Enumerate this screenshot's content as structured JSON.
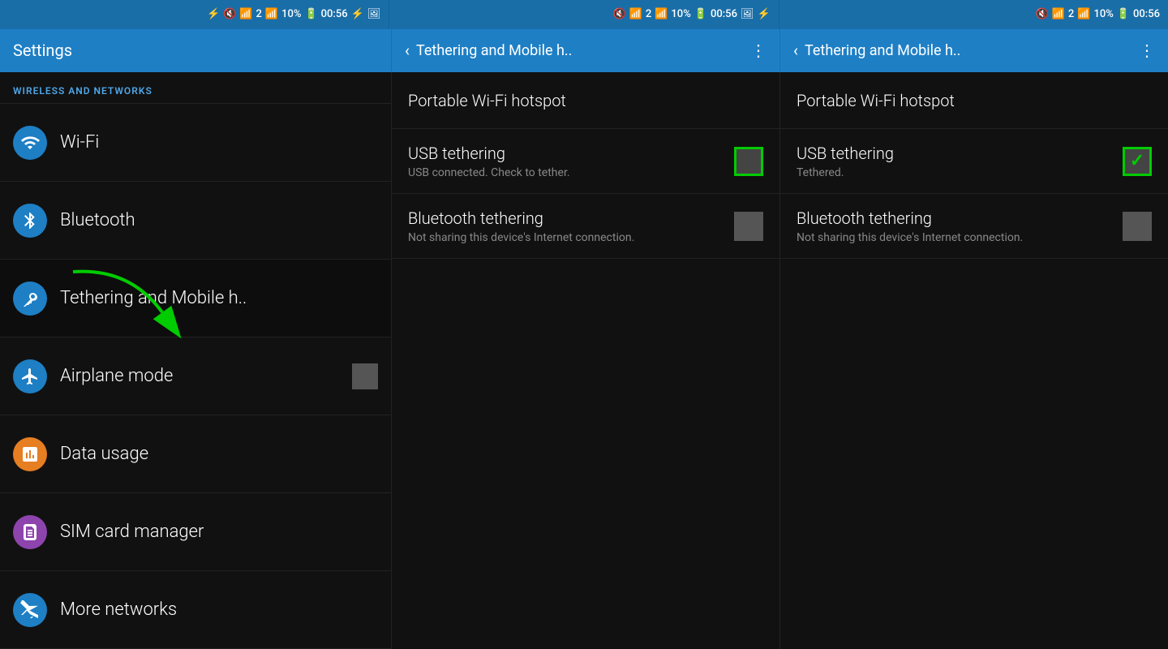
{
  "statusBar": {
    "segments": [
      {
        "icons": "⊕ 🔇 📶 2 📶 10% 🔋 00:56 ⚡ 🖼",
        "time": "00:56",
        "battery": "10%"
      },
      {
        "icons": "🔇 📶 2 📶 10% 🔋 00:56 🖼 ⚡",
        "time": "00:56",
        "battery": "10%"
      },
      {
        "icons": "🔇 📶 2 📶 10% 🔋 00:56",
        "time": "00:56",
        "battery": "10%"
      }
    ]
  },
  "topBar": {
    "settingsTitle": "Settings",
    "tetheringTitle": "Tethering and Mobile h..",
    "tetheringTitle2": "Tethering and Mobile h.."
  },
  "settings": {
    "sectionHeader": "WIRELESS AND NETWORKS",
    "items": [
      {
        "id": "wifi",
        "label": "Wi-Fi",
        "iconColor": "blue",
        "iconType": "wifi"
      },
      {
        "id": "bluetooth",
        "label": "Bluetooth",
        "iconColor": "blue",
        "iconType": "bluetooth"
      },
      {
        "id": "tethering",
        "label": "Tethering and Mobile h..",
        "iconColor": "blue",
        "iconType": "tethering",
        "active": true
      },
      {
        "id": "airplane",
        "label": "Airplane mode",
        "iconColor": "blue",
        "iconType": "airplane",
        "hasCheckbox": true
      },
      {
        "id": "datausage",
        "label": "Data usage",
        "iconColor": "orange",
        "iconType": "data"
      },
      {
        "id": "simcard",
        "label": "SIM card manager",
        "iconColor": "purple",
        "iconType": "sim"
      },
      {
        "id": "morenetworks",
        "label": "More networks",
        "iconColor": "blue",
        "iconType": "wifi2"
      }
    ]
  },
  "tethering": {
    "panels": [
      {
        "id": "left",
        "items": [
          {
            "id": "hotspot",
            "title": "Portable Wi-Fi hotspot",
            "subtitle": "",
            "type": "hotspot"
          },
          {
            "id": "usb",
            "title": "USB tethering",
            "subtitle": "USB connected. Check to tether.",
            "type": "checkbox",
            "checked": false,
            "greenBorder": true
          },
          {
            "id": "bluetooth",
            "title": "Bluetooth tethering",
            "subtitle": "Not sharing this device's Internet connection.",
            "type": "checkbox",
            "checked": false,
            "greenBorder": false
          }
        ]
      },
      {
        "id": "right",
        "items": [
          {
            "id": "hotspot",
            "title": "Portable Wi-Fi hotspot",
            "subtitle": "",
            "type": "hotspot"
          },
          {
            "id": "usb",
            "title": "USB tethering",
            "subtitle": "Tethered.",
            "type": "checkbox",
            "checked": true,
            "greenBorder": true
          },
          {
            "id": "bluetooth",
            "title": "Bluetooth tethering",
            "subtitle": "Not sharing this device's Internet connection.",
            "type": "checkbox",
            "checked": false,
            "greenBorder": false
          }
        ]
      }
    ]
  }
}
